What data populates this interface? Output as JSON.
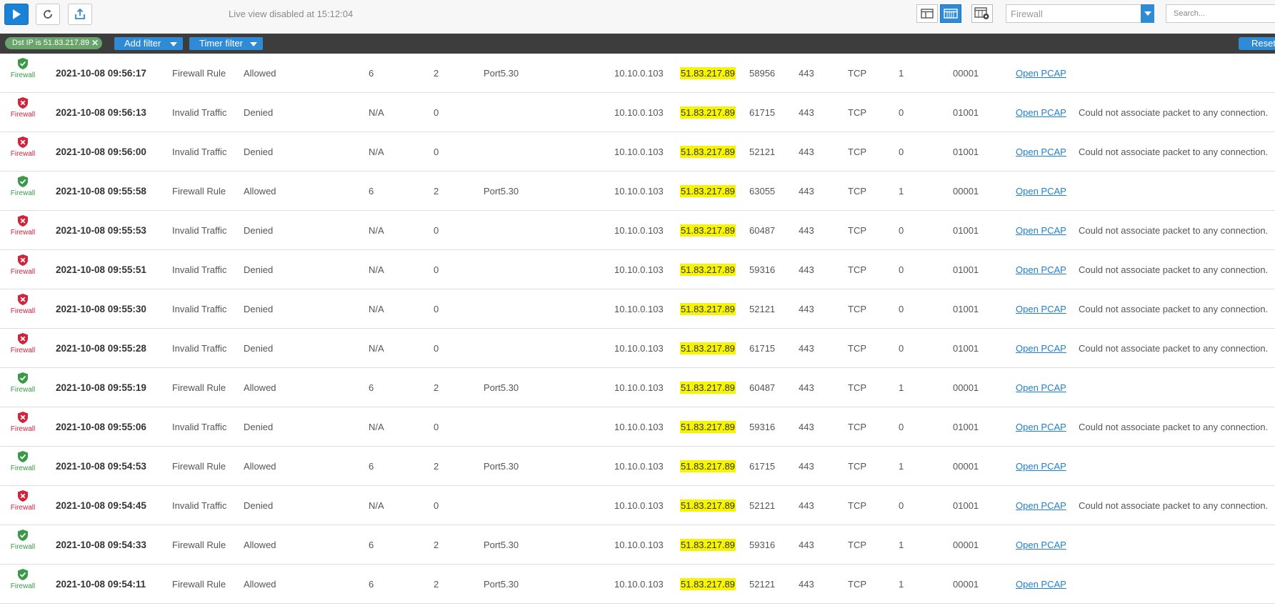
{
  "toolbar": {
    "live_status": "Live view disabled at 15:12:04",
    "module_select": "Firewall",
    "search_placeholder": "Search..."
  },
  "filters": {
    "active_chip": "Dst IP is 51.83.217.89",
    "add_filter": "Add filter",
    "timer_filter": "Timer filter",
    "reset": "Reset"
  },
  "colors": {
    "accent": "#2f8bd6",
    "allowed": "#3a9a4a",
    "denied": "#d2233a",
    "highlight": "#f7f400"
  },
  "rows": [
    {
      "status": "allowed",
      "module": "Firewall",
      "time": "2021-10-08 09:56:17",
      "log_type": "Firewall Rule",
      "action": "Allowed",
      "rule": "6",
      "policy": "2",
      "iface": "Port5.30",
      "src_ip": "10.10.0.103",
      "dst_ip": "51.83.217.89",
      "src_port": "58956",
      "dst_port": "443",
      "proto": "TCP",
      "flag": "1",
      "code": "00001",
      "pcap": "Open PCAP",
      "message": ""
    },
    {
      "status": "denied",
      "module": "Firewall",
      "time": "2021-10-08 09:56:13",
      "log_type": "Invalid Traffic",
      "action": "Denied",
      "rule": "N/A",
      "policy": "0",
      "iface": "",
      "src_ip": "10.10.0.103",
      "dst_ip": "51.83.217.89",
      "src_port": "61715",
      "dst_port": "443",
      "proto": "TCP",
      "flag": "0",
      "code": "01001",
      "pcap": "Open PCAP",
      "message": "Could not associate packet to any connection."
    },
    {
      "status": "denied",
      "module": "Firewall",
      "time": "2021-10-08 09:56:00",
      "log_type": "Invalid Traffic",
      "action": "Denied",
      "rule": "N/A",
      "policy": "0",
      "iface": "",
      "src_ip": "10.10.0.103",
      "dst_ip": "51.83.217.89",
      "src_port": "52121",
      "dst_port": "443",
      "proto": "TCP",
      "flag": "0",
      "code": "01001",
      "pcap": "Open PCAP",
      "message": "Could not associate packet to any connection."
    },
    {
      "status": "allowed",
      "module": "Firewall",
      "time": "2021-10-08 09:55:58",
      "log_type": "Firewall Rule",
      "action": "Allowed",
      "rule": "6",
      "policy": "2",
      "iface": "Port5.30",
      "src_ip": "10.10.0.103",
      "dst_ip": "51.83.217.89",
      "src_port": "63055",
      "dst_port": "443",
      "proto": "TCP",
      "flag": "1",
      "code": "00001",
      "pcap": "Open PCAP",
      "message": ""
    },
    {
      "status": "denied",
      "module": "Firewall",
      "time": "2021-10-08 09:55:53",
      "log_type": "Invalid Traffic",
      "action": "Denied",
      "rule": "N/A",
      "policy": "0",
      "iface": "",
      "src_ip": "10.10.0.103",
      "dst_ip": "51.83.217.89",
      "src_port": "60487",
      "dst_port": "443",
      "proto": "TCP",
      "flag": "0",
      "code": "01001",
      "pcap": "Open PCAP",
      "message": "Could not associate packet to any connection."
    },
    {
      "status": "denied",
      "module": "Firewall",
      "time": "2021-10-08 09:55:51",
      "log_type": "Invalid Traffic",
      "action": "Denied",
      "rule": "N/A",
      "policy": "0",
      "iface": "",
      "src_ip": "10.10.0.103",
      "dst_ip": "51.83.217.89",
      "src_port": "59316",
      "dst_port": "443",
      "proto": "TCP",
      "flag": "0",
      "code": "01001",
      "pcap": "Open PCAP",
      "message": "Could not associate packet to any connection."
    },
    {
      "status": "denied",
      "module": "Firewall",
      "time": "2021-10-08 09:55:30",
      "log_type": "Invalid Traffic",
      "action": "Denied",
      "rule": "N/A",
      "policy": "0",
      "iface": "",
      "src_ip": "10.10.0.103",
      "dst_ip": "51.83.217.89",
      "src_port": "52121",
      "dst_port": "443",
      "proto": "TCP",
      "flag": "0",
      "code": "01001",
      "pcap": "Open PCAP",
      "message": "Could not associate packet to any connection."
    },
    {
      "status": "denied",
      "module": "Firewall",
      "time": "2021-10-08 09:55:28",
      "log_type": "Invalid Traffic",
      "action": "Denied",
      "rule": "N/A",
      "policy": "0",
      "iface": "",
      "src_ip": "10.10.0.103",
      "dst_ip": "51.83.217.89",
      "src_port": "61715",
      "dst_port": "443",
      "proto": "TCP",
      "flag": "0",
      "code": "01001",
      "pcap": "Open PCAP",
      "message": "Could not associate packet to any connection."
    },
    {
      "status": "allowed",
      "module": "Firewall",
      "time": "2021-10-08 09:55:19",
      "log_type": "Firewall Rule",
      "action": "Allowed",
      "rule": "6",
      "policy": "2",
      "iface": "Port5.30",
      "src_ip": "10.10.0.103",
      "dst_ip": "51.83.217.89",
      "src_port": "60487",
      "dst_port": "443",
      "proto": "TCP",
      "flag": "1",
      "code": "00001",
      "pcap": "Open PCAP",
      "message": ""
    },
    {
      "status": "denied",
      "module": "Firewall",
      "time": "2021-10-08 09:55:06",
      "log_type": "Invalid Traffic",
      "action": "Denied",
      "rule": "N/A",
      "policy": "0",
      "iface": "",
      "src_ip": "10.10.0.103",
      "dst_ip": "51.83.217.89",
      "src_port": "59316",
      "dst_port": "443",
      "proto": "TCP",
      "flag": "0",
      "code": "01001",
      "pcap": "Open PCAP",
      "message": "Could not associate packet to any connection."
    },
    {
      "status": "allowed",
      "module": "Firewall",
      "time": "2021-10-08 09:54:53",
      "log_type": "Firewall Rule",
      "action": "Allowed",
      "rule": "6",
      "policy": "2",
      "iface": "Port5.30",
      "src_ip": "10.10.0.103",
      "dst_ip": "51.83.217.89",
      "src_port": "61715",
      "dst_port": "443",
      "proto": "TCP",
      "flag": "1",
      "code": "00001",
      "pcap": "Open PCAP",
      "message": ""
    },
    {
      "status": "denied",
      "module": "Firewall",
      "time": "2021-10-08 09:54:45",
      "log_type": "Invalid Traffic",
      "action": "Denied",
      "rule": "N/A",
      "policy": "0",
      "iface": "",
      "src_ip": "10.10.0.103",
      "dst_ip": "51.83.217.89",
      "src_port": "52121",
      "dst_port": "443",
      "proto": "TCP",
      "flag": "0",
      "code": "01001",
      "pcap": "Open PCAP",
      "message": "Could not associate packet to any connection."
    },
    {
      "status": "allowed",
      "module": "Firewall",
      "time": "2021-10-08 09:54:33",
      "log_type": "Firewall Rule",
      "action": "Allowed",
      "rule": "6",
      "policy": "2",
      "iface": "Port5.30",
      "src_ip": "10.10.0.103",
      "dst_ip": "51.83.217.89",
      "src_port": "59316",
      "dst_port": "443",
      "proto": "TCP",
      "flag": "1",
      "code": "00001",
      "pcap": "Open PCAP",
      "message": ""
    },
    {
      "status": "allowed",
      "module": "Firewall",
      "time": "2021-10-08 09:54:11",
      "log_type": "Firewall Rule",
      "action": "Allowed",
      "rule": "6",
      "policy": "2",
      "iface": "Port5.30",
      "src_ip": "10.10.0.103",
      "dst_ip": "51.83.217.89",
      "src_port": "52121",
      "dst_port": "443",
      "proto": "TCP",
      "flag": "1",
      "code": "00001",
      "pcap": "Open PCAP",
      "message": ""
    }
  ]
}
